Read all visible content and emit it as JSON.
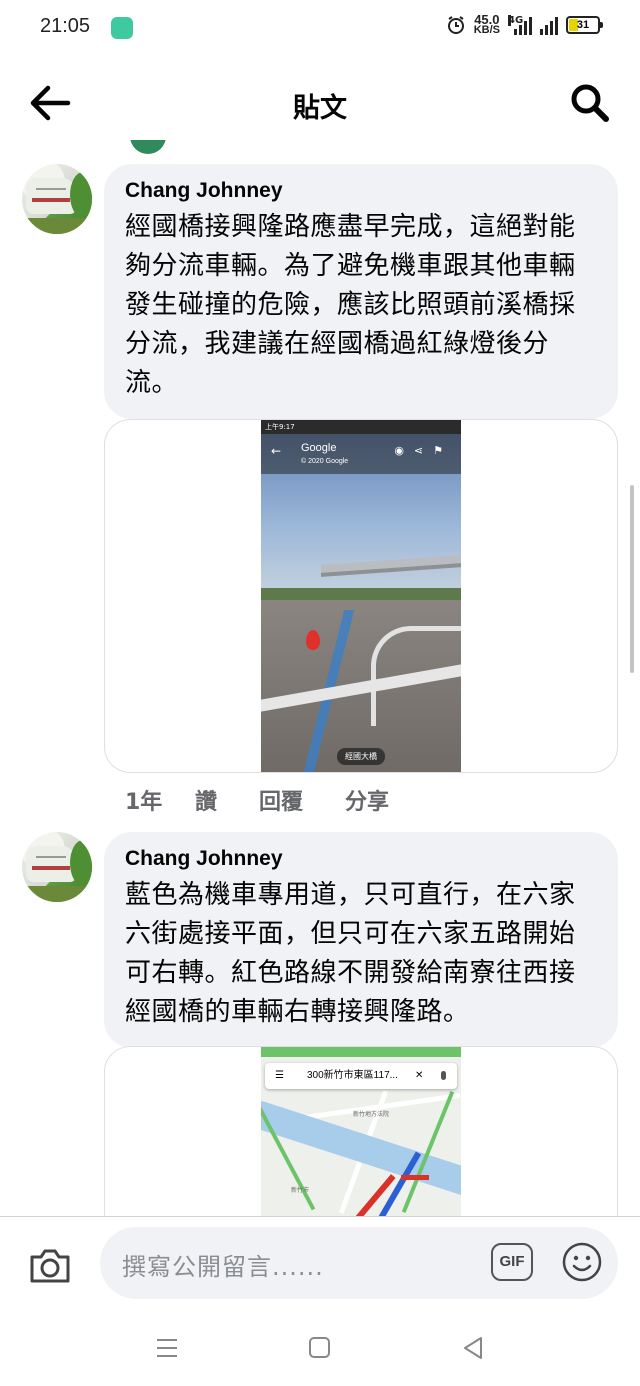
{
  "status_bar": {
    "time": "21:05",
    "net_speed_value": "45.0",
    "net_speed_unit": "KB/S",
    "network": "4G",
    "battery": "31",
    "battery_color": "#e8d300"
  },
  "header": {
    "title": "貼文",
    "back_icon": "arrow-left-icon",
    "search_icon": "search-icon"
  },
  "comments": [
    {
      "author": "Chang Johnney",
      "text": "經國橋接興隆路應盡早完成，這絕對能夠分流車輛。為了避免機車跟其他車輛發生碰撞的危險，應該比照頭前溪橋採分流，我建議在經國橋過紅綠燈後分流。",
      "attachment": {
        "topbar": "上午9:17",
        "title": "Google",
        "subtitle": "© 2020 Google",
        "place_label": "經國大橋"
      },
      "actions": {
        "time": "1年",
        "like": "讚",
        "reply": "回覆",
        "share": "分享"
      }
    },
    {
      "author": "Chang Johnney",
      "text": "藍色為機車專用道，只可直行，在六家六街處接平面，但只可在六家五路開始可右轉。紅色路線不開發給南寮往西接經國橋的車輛右轉接興隆路。",
      "attachment": {
        "search_text": "300新竹市東區117...",
        "map_label_1": "新竹地方法院",
        "map_label_2": "新竹市"
      }
    }
  ],
  "composer": {
    "placeholder": "撰寫公開留言......",
    "gif_label": "GIF",
    "camera_icon": "camera-icon",
    "emoji_icon": "smiley-icon"
  },
  "navbar": {
    "menu_icon": "menu-icon",
    "home_icon": "square-home-icon",
    "back_icon": "triangle-back-icon"
  }
}
